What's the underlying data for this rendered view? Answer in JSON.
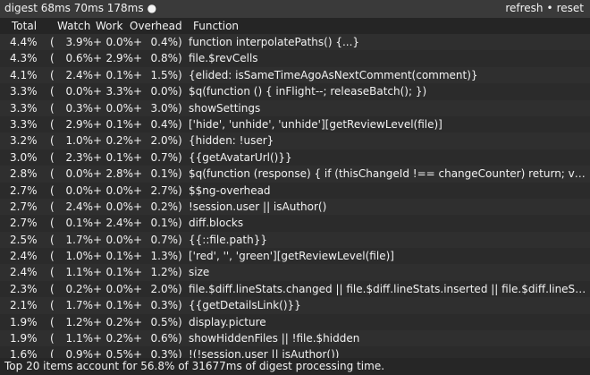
{
  "window": {
    "title": "digest 68ms 70ms 178ms",
    "status_dot": "●",
    "actions": {
      "refresh_label": "refresh",
      "separator": "•",
      "reset_label": "reset"
    }
  },
  "table": {
    "headers": {
      "total": "Total",
      "watch": "Watch",
      "work": "Work",
      "overhead": "Overhead",
      "function": "Function"
    },
    "rows": [
      {
        "total": "4.4%",
        "watch": "3.9%",
        "work": "0.0%",
        "overhead": "0.4%",
        "expr": "function interpolatePaths() {...}"
      },
      {
        "total": "4.3%",
        "watch": "0.6%",
        "work": "2.9%",
        "overhead": "0.8%",
        "expr": "file.$revCells"
      },
      {
        "total": "4.1%",
        "watch": "2.4%",
        "work": "0.1%",
        "overhead": "1.5%",
        "expr": "{elided: isSameTimeAgoAsNextComment(comment)}"
      },
      {
        "total": "3.3%",
        "watch": "0.0%",
        "work": "3.3%",
        "overhead": "0.0%",
        "expr": "$q(function () { inFlight--; releaseBatch(); })"
      },
      {
        "total": "3.3%",
        "watch": "0.3%",
        "work": "0.0%",
        "overhead": "3.0%",
        "expr": "showSettings"
      },
      {
        "total": "3.3%",
        "watch": "2.9%",
        "work": "0.1%",
        "overhead": "0.4%",
        "expr": "['hide', 'unhide', 'unhide'][getReviewLevel(file)]"
      },
      {
        "total": "3.2%",
        "watch": "1.0%",
        "work": "0.2%",
        "overhead": "2.0%",
        "expr": "{hidden: !user}"
      },
      {
        "total": "3.0%",
        "watch": "2.3%",
        "work": "0.1%",
        "overhead": "0.7%",
        "expr": "{{getAvatarUrl()}}"
      },
      {
        "total": "2.8%",
        "watch": "0.0%",
        "work": "2.8%",
        "overhead": "0.1%",
        "expr": "$q(function (response) { if (thisChangeId !== changeCounter) return; var n..."
      },
      {
        "total": "2.7%",
        "watch": "0.0%",
        "work": "0.0%",
        "overhead": "2.7%",
        "expr": "$$ng-overhead"
      },
      {
        "total": "2.7%",
        "watch": "2.4%",
        "work": "0.0%",
        "overhead": "0.2%",
        "expr": "!session.user || isAuthor()"
      },
      {
        "total": "2.7%",
        "watch": "0.1%",
        "work": "2.4%",
        "overhead": "0.1%",
        "expr": "diff.blocks"
      },
      {
        "total": "2.5%",
        "watch": "1.7%",
        "work": "0.0%",
        "overhead": "0.7%",
        "expr": " {{::file.path}}"
      },
      {
        "total": "2.4%",
        "watch": "1.0%",
        "work": "0.1%",
        "overhead": "1.3%",
        "expr": "['red', '', 'green'][getReviewLevel(file)]"
      },
      {
        "total": "2.4%",
        "watch": "1.1%",
        "work": "0.1%",
        "overhead": "1.2%",
        "expr": "size"
      },
      {
        "total": "2.3%",
        "watch": "0.2%",
        "work": "0.0%",
        "overhead": "2.0%",
        "expr": "file.$diff.lineStats.changed || file.$diff.lineStats.inserted || file.$diff.lineSt..."
      },
      {
        "total": "2.1%",
        "watch": "1.7%",
        "work": "0.1%",
        "overhead": "0.3%",
        "expr": "{{getDetailsLink()}}"
      },
      {
        "total": "1.9%",
        "watch": "1.2%",
        "work": "0.2%",
        "overhead": "0.5%",
        "expr": "display.picture"
      },
      {
        "total": "1.9%",
        "watch": "1.1%",
        "work": "0.2%",
        "overhead": "0.6%",
        "expr": "showHiddenFiles || !file.$hidden"
      },
      {
        "total": "1.6%",
        "watch": "0.9%",
        "work": "0.5%",
        "overhead": "0.3%",
        "expr": "!(!session.user || isAuthor())"
      }
    ]
  },
  "footer": {
    "summary": "Top 20 items account for 56.8% of 31677ms of digest processing time."
  },
  "colors": {
    "background": "#2f2f2f",
    "header_background": "#252525",
    "topbar_background": "#3a3a3a",
    "text": "#f2f2f2"
  }
}
